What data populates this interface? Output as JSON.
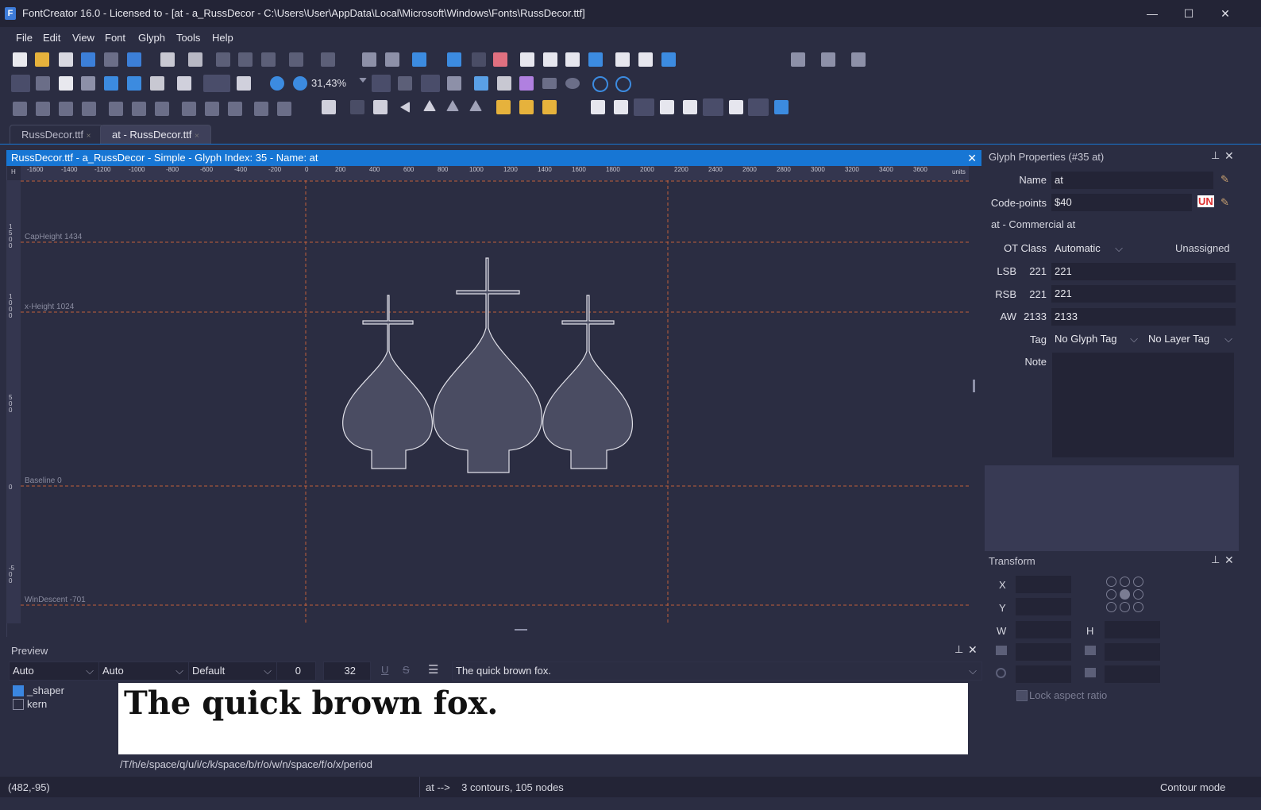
{
  "window": {
    "title": "FontCreator 16.0 - Licensed to  - [at - a_RussDecor - C:\\Users\\User\\AppData\\Local\\Microsoft\\Windows\\Fonts\\RussDecor.ttf]",
    "app_icon_letter": "F",
    "minimize": "—",
    "maximize": "☐",
    "close": "✕"
  },
  "menu": [
    "File",
    "Edit",
    "View",
    "Font",
    "Glyph",
    "Tools",
    "Help"
  ],
  "toolbar": {
    "zoom": "31,43%"
  },
  "tabs": [
    {
      "label": "RussDecor.ttf",
      "close": "×"
    },
    {
      "label": "at - RussDecor.ttf",
      "close": "×"
    }
  ],
  "editor": {
    "header": "RussDecor.ttf - a_RussDecor - Simple - Glyph Index: 35 - Name: at",
    "close": "✕",
    "ruler_units": "units",
    "ruler_h_corner": "H",
    "ruler_ticks": [
      "-1600",
      "-1400",
      "-1200",
      "-1000",
      "-800",
      "-600",
      "-400",
      "-200",
      "0",
      "200",
      "400",
      "600",
      "800",
      "1000",
      "1200",
      "1400",
      "1600",
      "1800",
      "2000",
      "2200",
      "2400",
      "2600",
      "2800",
      "3000",
      "3200",
      "3400",
      "3600"
    ],
    "v_ruler_labels": [
      "1500",
      "1000",
      "500",
      "0",
      "-500"
    ],
    "guides": {
      "capheight": "CapHeight 1434",
      "xheight": "x-Height 1024",
      "baseline": "Baseline 0",
      "windescent": "WinDescent -701"
    }
  },
  "preview": {
    "title": "Preview",
    "combo1": "Auto",
    "combo2": "Auto",
    "combo3": "Default",
    "spin1": "0",
    "spin2": "32",
    "underline": "U",
    "strike": "S",
    "text_input": "The quick brown fox.",
    "features": [
      {
        "label": "_shaper",
        "checked": true
      },
      {
        "label": "kern",
        "checked": false
      }
    ],
    "rendered_text": "The quick brown fox.",
    "glyph_string": "/T/h/e/space/q/u/i/c/k/space/b/r/o/w/n/space/f/o/x/period"
  },
  "glyph_properties": {
    "title": "Glyph Properties (#35 at)",
    "name_label": "Name",
    "name_value": "at",
    "codepoints_label": "Code-points",
    "codepoints_value": "$40",
    "unicode_badge": "UN",
    "description": "at - Commercial at",
    "otclass_label": "OT Class",
    "otclass_value": "Automatic",
    "otclass_status": "Unassigned",
    "lsb_label": "LSB",
    "lsb_current": "221",
    "lsb_value": "221",
    "rsb_label": "RSB",
    "rsb_current": "221",
    "rsb_value": "221",
    "aw_label": "AW",
    "aw_current": "2133",
    "aw_value": "2133",
    "tag_label": "Tag",
    "glyph_tag": "No Glyph Tag",
    "layer_tag": "No Layer Tag",
    "note_label": "Note"
  },
  "transform": {
    "title": "Transform",
    "x_label": "X",
    "y_label": "Y",
    "w_label": "W",
    "h_label": "H",
    "lock_label": "Lock aspect ratio"
  },
  "status": {
    "coords": "(482,-95)",
    "info": "at -->    3 contours, 105 nodes",
    "mode": "Contour mode"
  },
  "colors": {
    "accent": "#1776d4",
    "background": "#2b2d42",
    "guide": "#c0603a"
  }
}
